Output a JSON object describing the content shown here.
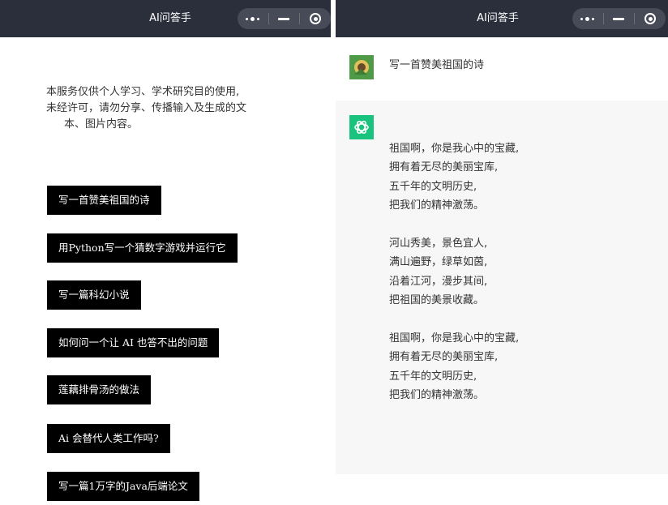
{
  "left_window": {
    "title": "AI问答手",
    "notice_lines": [
      "本服务仅供个人学习、学术研究目的使用,",
      "未经许可，请勿分享、传播输入及生成的文",
      "本、图片内容。"
    ],
    "suggestions": [
      "写一首赞美祖国的诗",
      "用Python写一个猜数字游戏并运行它",
      "写一篇科幻小说",
      "如何问一个让 AI 也答不出的问题",
      "莲藕排骨汤的做法",
      "Ai 会替代人类工作吗?",
      "写一篇1万字的Java后端论文"
    ]
  },
  "right_window": {
    "title": "AI问答手",
    "question": "写一首赞美祖国的诗",
    "answer_stanzas": [
      [
        "祖国啊，你是我心中的宝藏,",
        "拥有着无尽的美丽宝库,",
        "五千年的文明历史,",
        "把我们的精神激荡。"
      ],
      [
        "河山秀美，景色宜人,",
        "满山遍野，绿草如茵,",
        "沿着江河，漫步其间,",
        "把祖国的美景收藏。"
      ],
      [
        "祖国啊，你是我心中的宝藏,",
        "拥有着无尽的美丽宝库,",
        "五千年的文明历史,",
        "把我们的精神激荡。"
      ]
    ]
  },
  "icons": {
    "more": "more-dots-icon",
    "minimize": "minimize-icon",
    "close": "target-close-icon",
    "bot": "openai-logo-icon",
    "user": "user-avatar-icon"
  },
  "colors": {
    "topbar": "#2b2f3b",
    "capsule": "#474b57",
    "suggestion_bg": "#000000",
    "answer_bg": "#f7f7f8",
    "bot_avatar": "#19c37d"
  }
}
